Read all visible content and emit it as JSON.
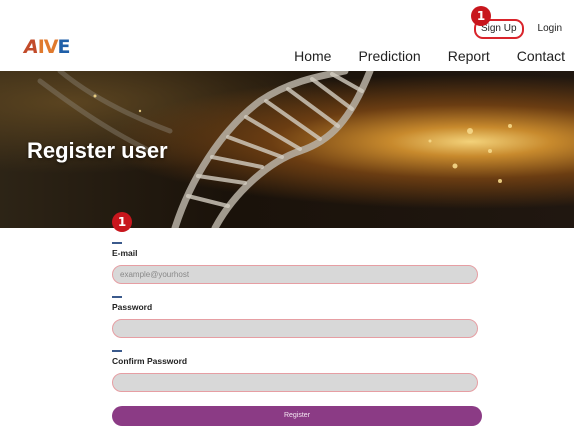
{
  "brand": {
    "logo_text": "AIVE"
  },
  "top_links": {
    "signup_label": "Sign Up",
    "login_label": "Login"
  },
  "nav": {
    "items": [
      {
        "label": "Home"
      },
      {
        "label": "Prediction"
      },
      {
        "label": "Report"
      },
      {
        "label": "Contact"
      }
    ]
  },
  "hero": {
    "title": "Register user"
  },
  "form": {
    "email": {
      "label": "E-mail",
      "placeholder": "example@yourhost",
      "value": ""
    },
    "password": {
      "label": "Password",
      "value": ""
    },
    "confirm_password": {
      "label": "Confirm Password",
      "value": ""
    },
    "register_label": "Register"
  },
  "annotations": [
    {
      "number": "1"
    },
    {
      "number": "1"
    }
  ],
  "colors": {
    "accent_button": "#8b3b85",
    "badge": "#c8161d",
    "input_border": "#e69ea3",
    "input_bg": "#d8d8d8"
  }
}
